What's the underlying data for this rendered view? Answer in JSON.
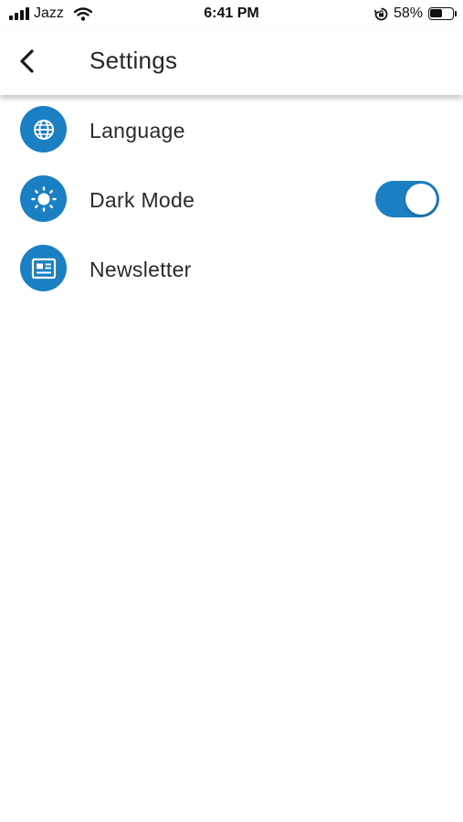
{
  "status_bar": {
    "carrier": "Jazz",
    "time": "6:41 PM",
    "battery_percent_label": "58%",
    "battery_level": 0.58,
    "icons": [
      "signal-icon",
      "wifi-icon",
      "rotation-lock-icon",
      "battery-icon"
    ]
  },
  "header": {
    "title": "Settings",
    "back_icon": "chevron-left-icon"
  },
  "settings": {
    "items": [
      {
        "label": "Language",
        "icon": "globe-icon"
      },
      {
        "label": "Dark Mode",
        "icon": "brightness-icon",
        "toggle_on": true
      },
      {
        "label": "Newsletter",
        "icon": "newspaper-icon"
      }
    ]
  },
  "colors": {
    "accent": "#1b7fc3",
    "text": "#2a2a2a",
    "background": "#ffffff"
  }
}
